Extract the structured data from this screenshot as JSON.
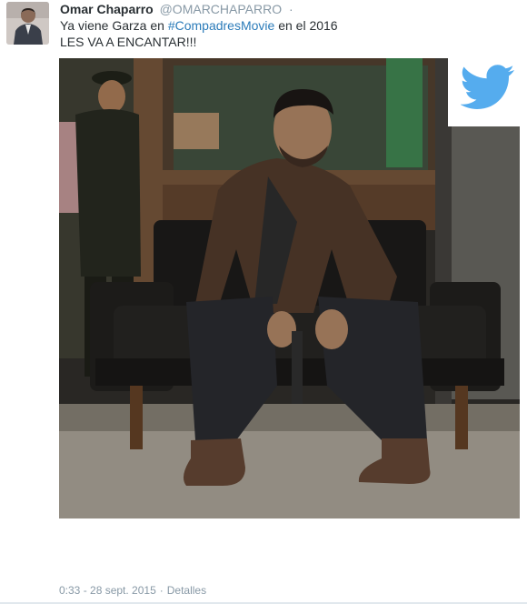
{
  "tweet": {
    "author_name": "Omar Chaparro",
    "handle": "@OMARCHAPARRO",
    "separator": "·",
    "text_line1_prefix": "Ya viene Garza en ",
    "hashtag": "#CompadresMovie",
    "text_line1_suffix": " en el 2016",
    "text_line2": "LES VA A ENCANTAR!!!",
    "timestamp": "0:33 - 28 sept. 2015",
    "footer_separator": "·",
    "details_link": "Detalles"
  },
  "icons": {
    "badge": "twitter-bird-icon"
  },
  "colors": {
    "link": "#2b7bb9",
    "muted": "#8899a6",
    "text": "#292f33",
    "twitter_blue": "#55acee"
  }
}
